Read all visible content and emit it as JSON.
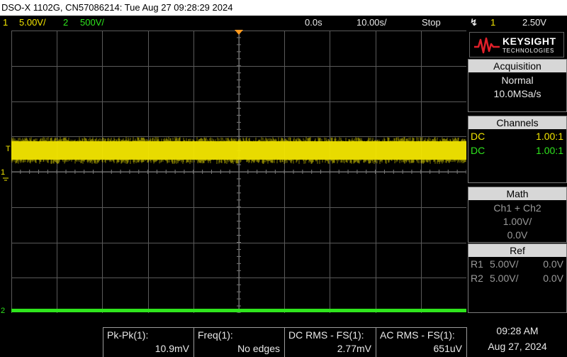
{
  "title_bar": "DSO-X 1102G, CN57086214: Tue Aug 27 09:28:29 2024",
  "status": {
    "ch1_num": "1",
    "ch1_scale": "5.00V/",
    "ch2_num": "2",
    "ch2_scale": "500V/",
    "time_delay": "0.0s",
    "time_scale": "10.00s/",
    "run_state": "Stop",
    "trigger_icon": "trigger-edge-icon",
    "trigger_source": "1",
    "trigger_level": "2.50V"
  },
  "logo": {
    "brand": "KEYSIGHT",
    "sub": "TECHNOLOGIES"
  },
  "acquisition": {
    "header": "Acquisition",
    "mode": "Normal",
    "rate": "10.0MSa/s"
  },
  "channels": {
    "header": "Channels",
    "rows": [
      {
        "coupling": "DC",
        "probe": "1.00:1",
        "color": "#f3e600"
      },
      {
        "coupling": "DC",
        "probe": "1.00:1",
        "color": "#2fe51d"
      }
    ]
  },
  "math": {
    "header": "Math",
    "function": "Ch1 + Ch2",
    "scale": "1.00V/",
    "offset": "0.0V"
  },
  "ref": {
    "header": "Ref",
    "rows": [
      {
        "name": "R1",
        "scale": "5.00V/",
        "offset": "0.0V"
      },
      {
        "name": "R2",
        "scale": "5.00V/",
        "offset": "0.0V"
      }
    ]
  },
  "markers": {
    "ch1": "1",
    "ch2": "2",
    "trigger": "T"
  },
  "measurements": [
    {
      "label": "Pk-Pk(1):",
      "value": "10.9mV"
    },
    {
      "label": "Freq(1):",
      "value": "No edges"
    },
    {
      "label": "DC RMS - FS(1):",
      "value": "2.77mV"
    },
    {
      "label": "AC RMS - FS(1):",
      "value": "651uV"
    }
  ],
  "clock": {
    "time": "09:28 AM",
    "date": "Aug 27, 2024"
  },
  "colors": {
    "ch1": "#f3e600",
    "ch2": "#2fe51d",
    "grid": "#5a5a5a",
    "trigger_marker": "#ff9a1f"
  }
}
